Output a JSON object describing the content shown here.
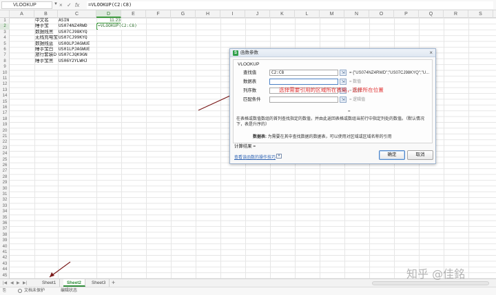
{
  "formula_bar": {
    "name_box": "VLOOKUP",
    "cancel_icon": "×",
    "confirm_icon": "✓",
    "fx_icon": "fx",
    "formula": "=VLOOKUP(C2:C8)"
  },
  "columns": [
    "A",
    "B",
    "C",
    "D",
    "E",
    "F",
    "G",
    "H",
    "I",
    "J",
    "K",
    "L",
    "M",
    "N",
    "O",
    "P",
    "Q",
    "R",
    "S"
  ],
  "selected_column": "D",
  "rows": [
    "1",
    "2",
    "3",
    "4",
    "5",
    "6",
    "7",
    "8",
    "9",
    "10",
    "11",
    "12",
    "13",
    "14",
    "15",
    "16",
    "17",
    "18",
    "19",
    "20",
    "21",
    "22",
    "23",
    "24",
    "25",
    "26",
    "27",
    "28",
    "29",
    "30",
    "31",
    "32",
    "33",
    "34",
    "35",
    "36",
    "37",
    "38",
    "39",
    "40",
    "41",
    "42",
    "43",
    "44",
    "45"
  ],
  "selected_row": "2",
  "cells": {
    "B1": "中文名",
    "C1": "ASIN",
    "D1": "11.23",
    "B2": "睡手宝",
    "C2": "US074NZ4RWD",
    "B3": "数据线黑",
    "C3": "US07CJ98KYQ",
    "B4": "无线充电宝",
    "C4": "US07CJ99KYQ",
    "B5": "数据线蓝",
    "C5": "US0OLPJAGWUE",
    "B6": "睡手宝白",
    "C6": "US01LPJAGWUE",
    "B7": "旅行套装D",
    "C7": "US07CJQK9GN",
    "B8": "睡手宝黑",
    "C8": "US06Y2YLWHJ"
  },
  "active_cell_text": "=VLOOKUP(C2:C8)",
  "dialog": {
    "title": "函数参数",
    "close_icon": "×",
    "function_name": "VLOOKUP",
    "args": [
      {
        "label": "查找值",
        "value": "C2:C8",
        "result": "= {\"US074NZ4RWD\";\"US07CJ98KYQ\";\"U...",
        "grey": false
      },
      {
        "label": "数据表",
        "value": "",
        "result": "= 数值",
        "grey": true
      },
      {
        "label": "列序数",
        "value": "",
        "result": "= 数值",
        "grey": true
      },
      {
        "label": "匹配条件",
        "value": "",
        "result": "= 逻辑值",
        "grey": true
      }
    ],
    "annotation": "选择需要引用的区域所在表格，选择所在位置",
    "equals": "=",
    "description": "在表格或数值数组的首列查找指定的数值，并由此返回表格或数组当前行中指定列处的数值。（默认情况下，表是升序的）",
    "param_name": "数据表:",
    "param_desc": "为需要在其中查找数据的数据表，可以使用对区域或区域名称的引用",
    "calc_result": "计算结果 =",
    "help_link": "查看该函数的操作技巧",
    "ok": "确定",
    "cancel": "取消"
  },
  "sheets": [
    "Sheet1",
    "Sheet2",
    "Sheet3"
  ],
  "active_sheet": "Sheet2",
  "add_sheet": "+",
  "status": {
    "protect": "文档未保护",
    "mode": "编辑状态"
  },
  "watermark": "知乎 @佳銘",
  "colors": {
    "accent_green": "#2f8d3a",
    "annotation_red": "#e03030",
    "arrow_dark_red": "#7a1a1a"
  }
}
